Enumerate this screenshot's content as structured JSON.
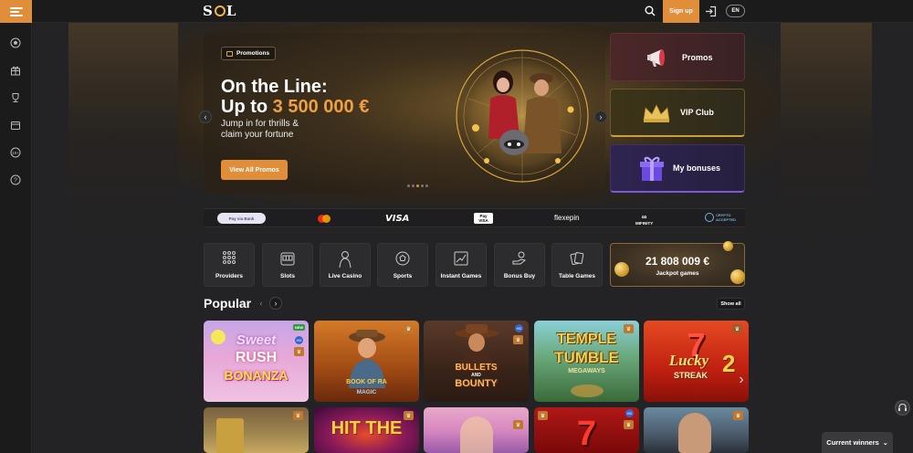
{
  "header": {
    "logo_text": "S",
    "logo_text_end": "L",
    "signup_label": "Sign up",
    "lang_label": "EN"
  },
  "sidebar": {
    "items": [
      {
        "icon": "sports-ball-icon"
      },
      {
        "icon": "gift-icon"
      },
      {
        "icon": "trophy-icon"
      },
      {
        "icon": "calendar-icon"
      },
      {
        "icon": "18-plus-icon"
      },
      {
        "icon": "help-icon"
      }
    ]
  },
  "hero": {
    "tag": "Promotions",
    "title_line1": "On the Line:",
    "title_prefix": "Up to ",
    "title_amount": "3 500 000 €",
    "subtitle": "Jump in for thrills & claim your fortune",
    "cta": "View All Promos",
    "active_slide": 2,
    "slide_count": 5
  },
  "side_cards": [
    {
      "label": "Promos"
    },
    {
      "label": "VIP Club"
    },
    {
      "label": "My bonuses"
    }
  ],
  "payments": {
    "bank": "Pay via Bank",
    "visa": "VISA",
    "apple": "Pay",
    "apple_sub": "VISA",
    "flexepin": "flexepin",
    "mifinity": "MIFINITY",
    "crypto": "CRYPTO ACCEPTED"
  },
  "categories": [
    {
      "label": "Providers"
    },
    {
      "label": "Slots"
    },
    {
      "label": "Live Casino"
    },
    {
      "label": "Sports"
    },
    {
      "label": "Instant Games"
    },
    {
      "label": "Bonus Buy"
    },
    {
      "label": "Table Games"
    }
  ],
  "jackpot": {
    "amount": "21 808 009 €",
    "label": "Jackpot games"
  },
  "popular": {
    "title": "Popular",
    "show_all": "Show all",
    "badge_new": "NEW",
    "badge_hd": "HD",
    "games": [
      {
        "title_line1": "Sweet",
        "title_line2": "RUSH",
        "title_line3": "BONANZA"
      },
      {
        "title_line1": "BOOK OF RA",
        "title_line2": "MAGIC"
      },
      {
        "title_line1": "BULLETS",
        "title_line2": "AND",
        "title_line3": "BOUNTY"
      },
      {
        "title_line1": "TEMPLE",
        "title_line2": "TUMBLE",
        "title_line3": "MEGAWAYS"
      },
      {
        "title_line1": "Lucky",
        "title_line2": "STREAK",
        "title_line3": "2"
      }
    ],
    "row2": [
      {
        "title": ""
      },
      {
        "title": "HIT THE"
      },
      {
        "title": ""
      },
      {
        "title": "7"
      },
      {
        "title": ""
      }
    ]
  },
  "footer": {
    "winners_label": "Current winners"
  }
}
